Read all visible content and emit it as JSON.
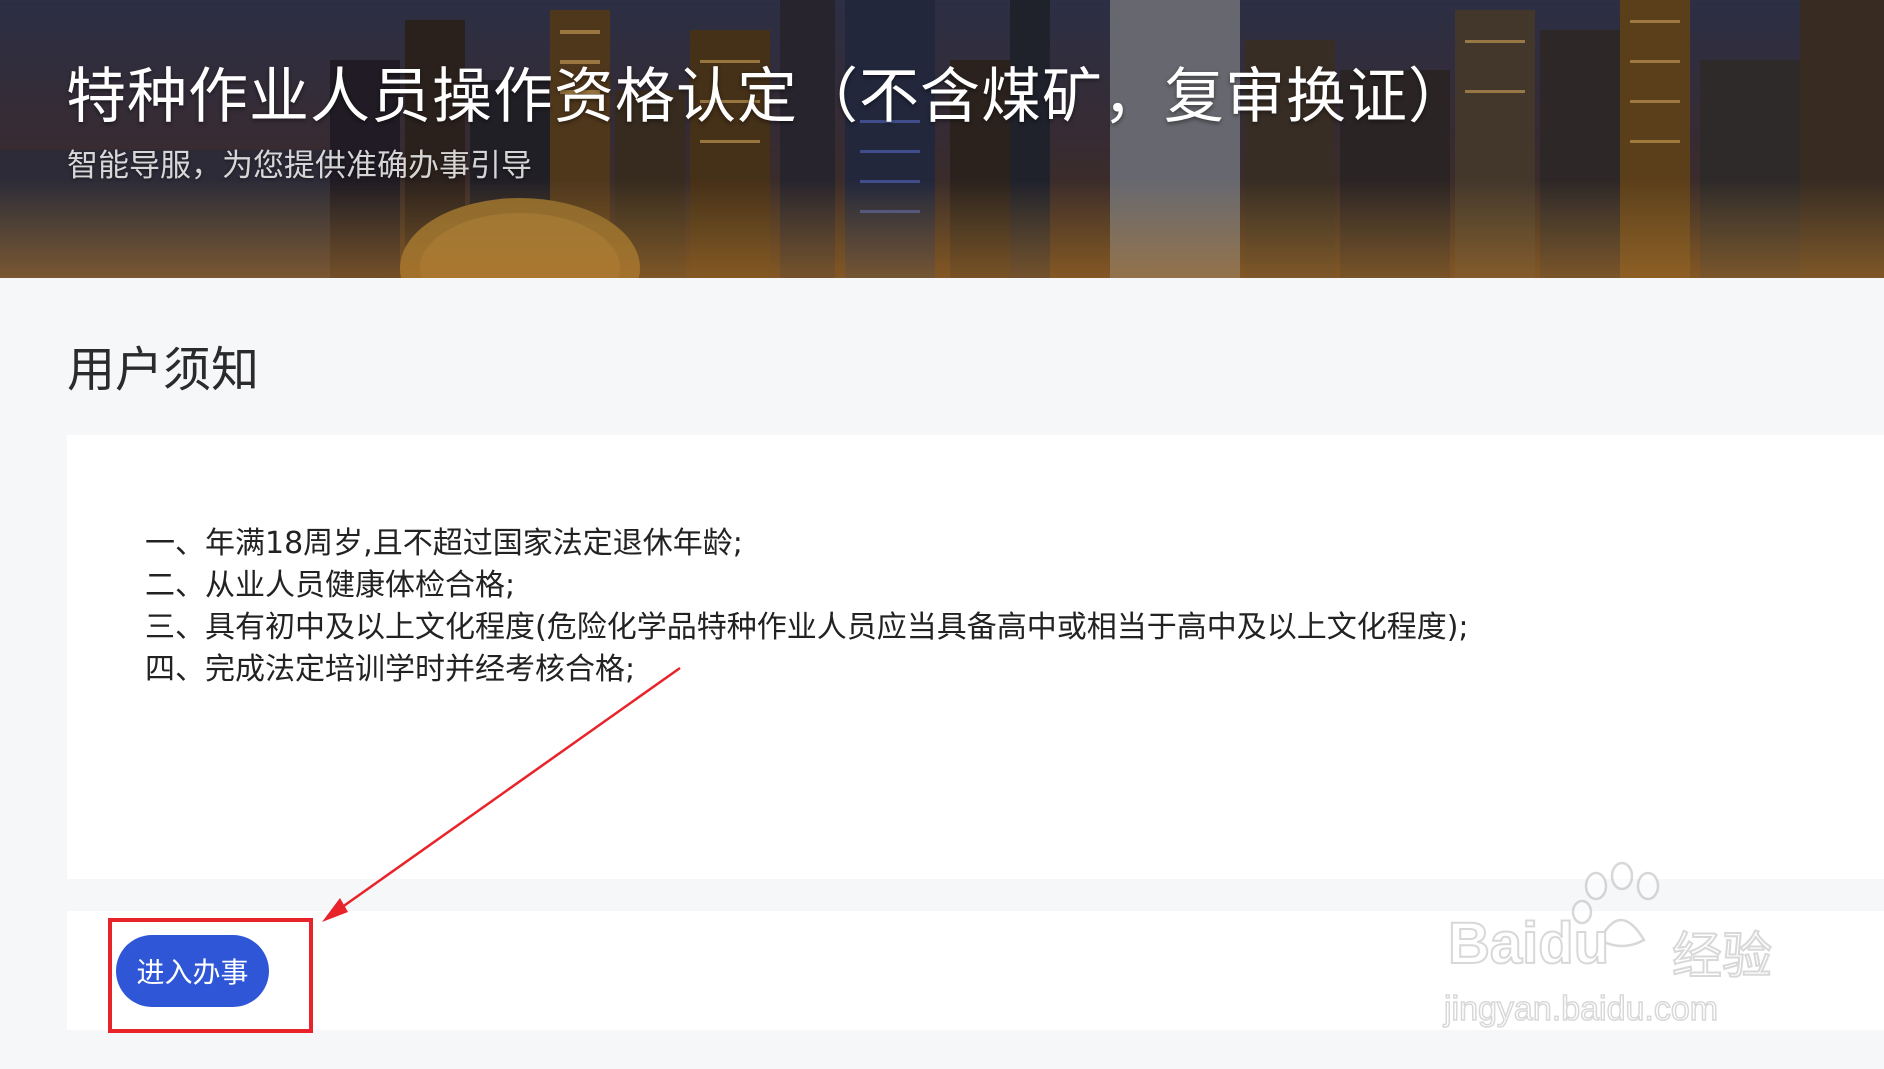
{
  "banner": {
    "title": "特种作业人员操作资格认定（不含煤矿，复审换证）",
    "subtitle": "智能导服，为您提供准确办事引导"
  },
  "notice": {
    "heading": "用户须知",
    "items": [
      "一、年满18周岁,且不超过国家法定退休年龄;",
      "二、从业人员健康体检合格;",
      "三、具有初中及以上文化程度(危险化学品特种作业人员应当具备高中或相当于高中及以上文化程度);",
      "四、完成法定培训学时并经考核合格;"
    ]
  },
  "actions": {
    "enter_label": "进入办事"
  },
  "watermark": {
    "brand": "Bai",
    "brand_suffix": "du",
    "product": "经验",
    "url": "jingyan.baidu.com"
  },
  "colors": {
    "primary_button": "#2f56d7",
    "annotation_red": "#e8242a",
    "page_background": "#f6f7f9",
    "card_background": "#ffffff"
  },
  "icons": [
    "paw-icon",
    "annotation-arrow-icon"
  ]
}
